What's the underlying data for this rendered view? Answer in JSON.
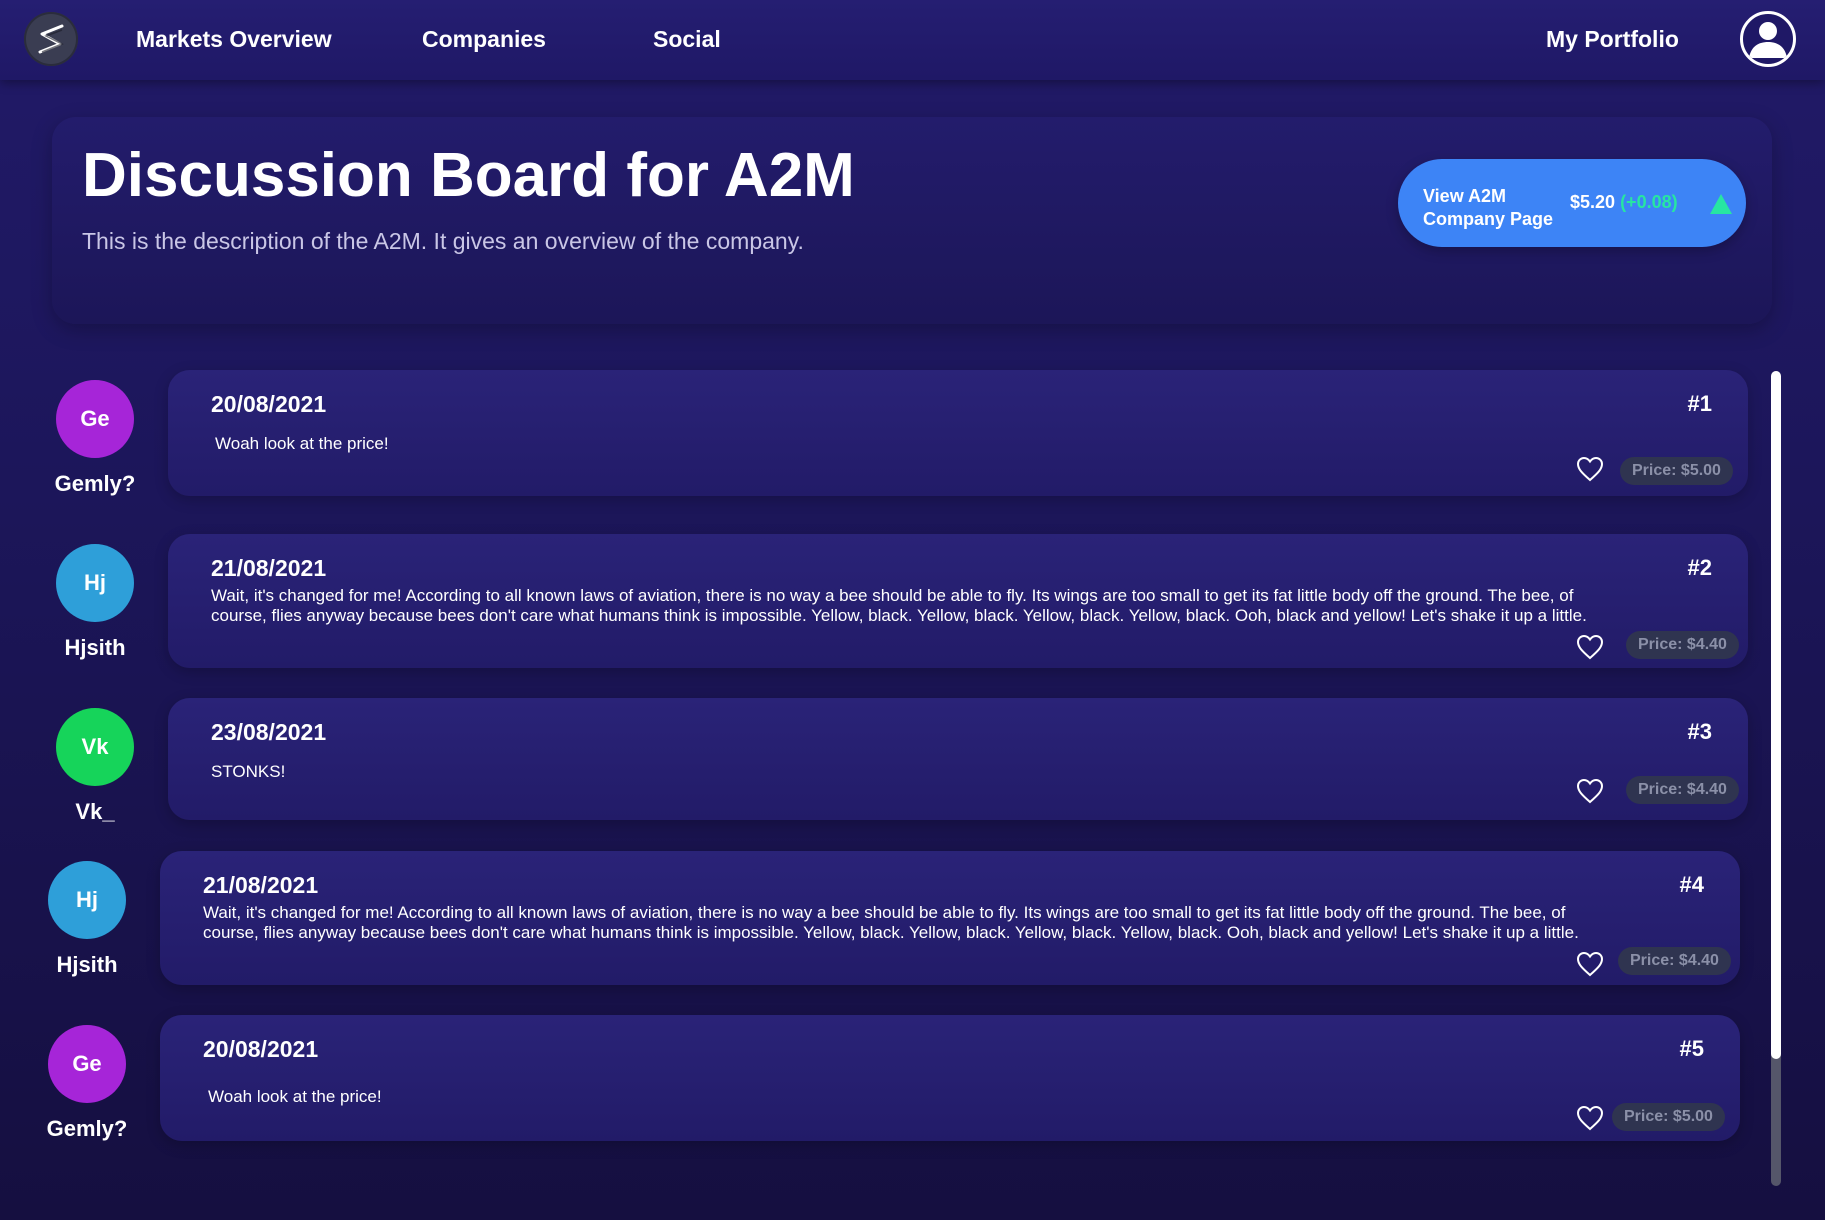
{
  "nav": {
    "links": [
      "Markets Overview",
      "Companies",
      "Social"
    ],
    "portfolio": "My Portfolio",
    "logo_icon": "logo-s-icon",
    "account_icon": "user-account-icon"
  },
  "header": {
    "title": "Discussion Board for A2M",
    "description": "This is the description of the A2M. It gives an overview of the company.",
    "company_button": {
      "label": "View A2M Company Page",
      "price": "$5.20",
      "change": "(+0.08)",
      "trend_icon": "triangle-up-icon"
    }
  },
  "colors": {
    "accent_blue": "#3d84f6",
    "positive_green": "#27e6a2",
    "avatar_ge": "#a625d8",
    "avatar_hj": "#2e9fd9",
    "avatar_vk": "#16d45a"
  },
  "posts": [
    {
      "initials": "Ge",
      "username": "Gemly?",
      "date": "20/08/2021",
      "number": "#1",
      "text": "Woah look at the price!",
      "price": "Price: $5.00"
    },
    {
      "initials": "Hj",
      "username": "Hjsith",
      "date": "21/08/2021",
      "number": "#2",
      "text": "Wait, it's changed for me! According to all known laws of aviation, there is no way a bee should be able to fly. Its wings are too small to get its fat little body off the ground. The bee, of course, flies anyway because bees don't care what humans think is impossible. Yellow, black. Yellow, black. Yellow, black. Yellow, black. Ooh, black and yellow! Let's shake it up a little.",
      "price": "Price: $4.40"
    },
    {
      "initials": "Vk",
      "username": "Vk_",
      "date": "23/08/2021",
      "number": "#3",
      "text": "STONKS!",
      "price": "Price: $4.40"
    },
    {
      "initials": "Hj",
      "username": "Hjsith",
      "date": "21/08/2021",
      "number": "#4",
      "text": "Wait, it's changed for me! According to all known laws of aviation, there is no way a bee should be able to fly. Its wings are too small to get its fat little body off the ground. The bee, of course, flies anyway because bees don't care what humans think is impossible. Yellow, black. Yellow, black. Yellow, black. Yellow, black. Ooh, black and yellow! Let's shake it up a little.",
      "price": "Price: $4.40"
    },
    {
      "initials": "Ge",
      "username": "Gemly?",
      "date": "20/08/2021",
      "number": "#5",
      "text": "Woah look at the price!",
      "price": "Price: $5.00"
    }
  ],
  "scroll_position": 0.0
}
